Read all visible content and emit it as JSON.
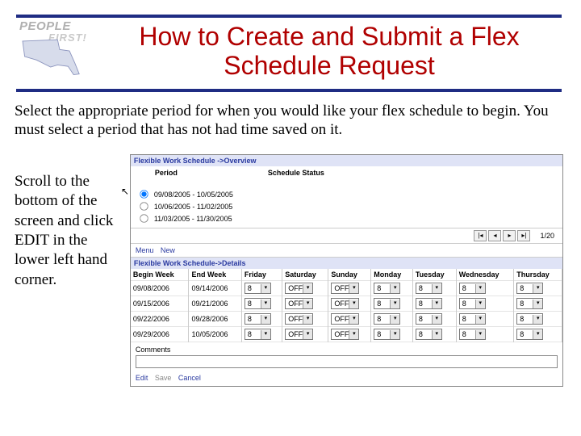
{
  "logo": {
    "line1": "PEOPLE",
    "line2": "FIRST!"
  },
  "title": "How to Create and Submit a Flex Schedule Request",
  "lead_text": "Select the appropriate period for when you would like your flex schedule to begin.  You must select a period that has not had time saved on it.",
  "side_text": "Scroll to the bottom of the screen and click EDIT in the lower left hand corner.",
  "overview": {
    "header": "Flexible Work Schedule ->Overview",
    "col_period": "Period",
    "col_status": "Schedule Status",
    "rows": [
      {
        "label": "09/08/2005 - 10/05/2005"
      },
      {
        "label": "10/06/2005 - 11/02/2005"
      },
      {
        "label": "11/03/2005 - 11/30/2005"
      }
    ],
    "pager": {
      "first": "|◂",
      "prev": "◂",
      "next": "▸",
      "last": "▸|",
      "page": "1/20"
    }
  },
  "menubar": {
    "menu": "Menu",
    "new": "New"
  },
  "details": {
    "header": "Flexible Work Schedule->Details",
    "cols": [
      "Begin Week",
      "End Week",
      "Friday",
      "Saturday",
      "Sunday",
      "Monday",
      "Tuesday",
      "Wednesday",
      "Thursday"
    ],
    "rows": [
      {
        "begin": "09/08/2006",
        "end": "09/14/2006",
        "vals": [
          "8",
          "OFF",
          "OFF",
          "8",
          "8",
          "8",
          "8"
        ]
      },
      {
        "begin": "09/15/2006",
        "end": "09/21/2006",
        "vals": [
          "8",
          "OFF",
          "OFF",
          "8",
          "8",
          "8",
          "8"
        ]
      },
      {
        "begin": "09/22/2006",
        "end": "09/28/2006",
        "vals": [
          "8",
          "OFF",
          "OFF",
          "8",
          "8",
          "8",
          "8"
        ]
      },
      {
        "begin": "09/29/2006",
        "end": "10/05/2006",
        "vals": [
          "8",
          "OFF",
          "OFF",
          "8",
          "8",
          "8",
          "8"
        ]
      }
    ],
    "comments_label": "Comments"
  },
  "footer": {
    "edit": "Edit",
    "save": "Save",
    "cancel": "Cancel"
  }
}
